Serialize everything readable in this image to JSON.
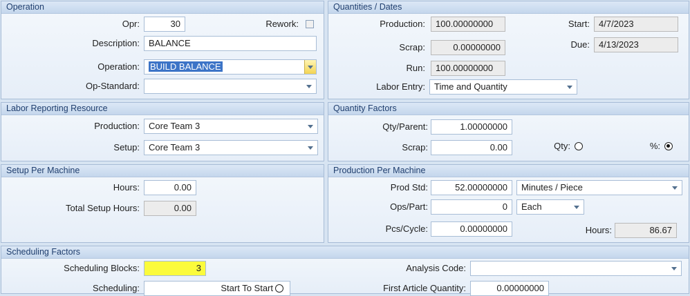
{
  "operation": {
    "title": "Operation",
    "opr_label": "Opr:",
    "opr_value": "30",
    "rework_label": "Rework:",
    "description_label": "Description:",
    "description_value": "BALANCE",
    "operation_label": "Operation:",
    "operation_value": "BUILD BALANCE",
    "opstandard_label": "Op-Standard:",
    "opstandard_value": ""
  },
  "quantities": {
    "title": "Quantities / Dates",
    "production_label": "Production:",
    "production_value": "100.00000000",
    "scrap_label": "Scrap:",
    "scrap_value": "0.00000000",
    "run_label": "Run:",
    "run_value": "100.00000000",
    "labor_entry_label": "Labor Entry:",
    "labor_entry_value": "Time and Quantity",
    "start_label": "Start:",
    "start_value": "4/7/2023",
    "due_label": "Due:",
    "due_value": "4/13/2023"
  },
  "labor": {
    "title": "Labor Reporting Resource",
    "production_label": "Production:",
    "production_value": "Core Team 3",
    "setup_label": "Setup:",
    "setup_value": "Core Team 3"
  },
  "qty_factors": {
    "title": "Quantity Factors",
    "qty_parent_label": "Qty/Parent:",
    "qty_parent_value": "1.00000000",
    "scrap_label": "Scrap:",
    "scrap_value": "0.00",
    "qty_label": "Qty:",
    "pct_label": "%:"
  },
  "setup_machine": {
    "title": "Setup Per Machine",
    "hours_label": "Hours:",
    "hours_value": "0.00",
    "total_label": "Total Setup Hours:",
    "total_value": "0.00"
  },
  "prod_machine": {
    "title": "Production Per Machine",
    "prod_std_label": "Prod Std:",
    "prod_std_value": "52.00000000",
    "prod_std_unit": "Minutes / Piece",
    "ops_part_label": "Ops/Part:",
    "ops_part_value": "0",
    "ops_part_unit": "Each",
    "pcs_cycle_label": "Pcs/Cycle:",
    "pcs_cycle_value": "0.00000000",
    "hours_label": "Hours:",
    "hours_value": "86.67"
  },
  "scheduling": {
    "title": "Scheduling Factors",
    "blocks_label": "Scheduling Blocks:",
    "blocks_value": "3",
    "analysis_label": "Analysis Code:",
    "analysis_value": "",
    "scheduling_label": "Scheduling:",
    "scheduling_value": "Start To Start",
    "first_article_label": "First Article Quantity:",
    "first_article_value": "0.00000000"
  },
  "colors": {
    "highlight": "#fbfb3c",
    "selection": "#3c74c7",
    "panel_title": "#1f3e6e"
  }
}
